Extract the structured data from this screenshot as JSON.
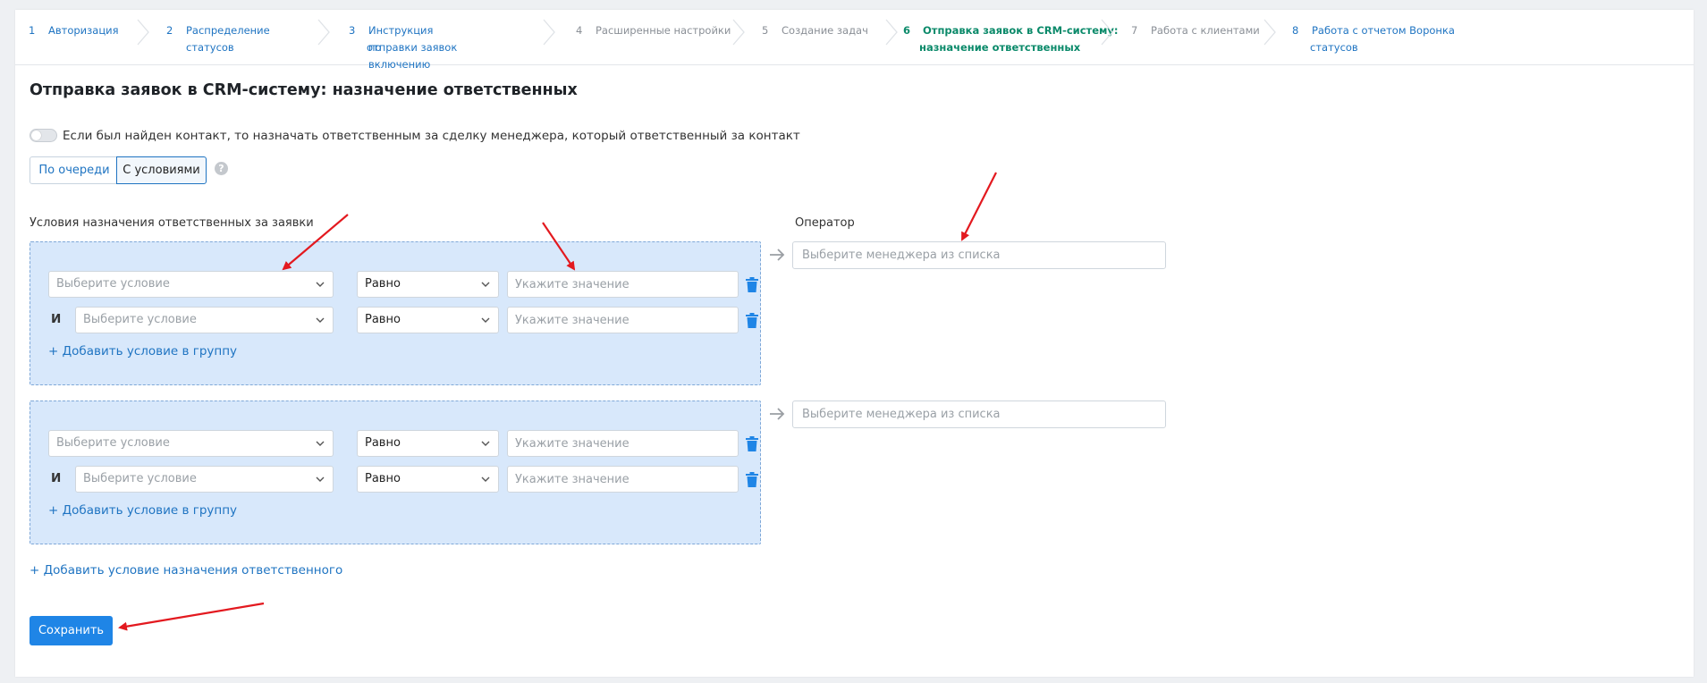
{
  "steps": [
    {
      "num": "1",
      "label": "Авторизация"
    },
    {
      "num": "2",
      "label": "Распределение статусов"
    },
    {
      "num": "3",
      "label_line1": "Инструкция по включению",
      "label_line2": "отправки заявок"
    },
    {
      "num": "4",
      "label": "Расширенные настройки"
    },
    {
      "num": "5",
      "label": "Создание задач"
    },
    {
      "num": "6",
      "label_line1": "Отправка заявок в CRM-систему:",
      "label_line2": "назначение ответственных"
    },
    {
      "num": "7",
      "label": "Работа с клиентами"
    },
    {
      "num": "8",
      "label_line1": "Работа с отчетом Воронка",
      "label_line2": "статусов"
    }
  ],
  "page": {
    "title": "Отправка заявок в CRM-систему: назначение ответственных",
    "toggle_label": "Если был найден контакт, то назначать ответственным за сделку менеджера, который ответственный за контакт",
    "mode_queue": "По очереди",
    "mode_conditions": "С условиями",
    "help": "?",
    "conditions_label": "Условия назначения ответственных за заявки",
    "operator_label": "Оператор"
  },
  "form": {
    "condition_placeholder": "Выберите условие",
    "operator_value": "Равно",
    "value_placeholder": "Укажите значение",
    "and_label": "И",
    "add_to_group": "+ Добавить условие в группу",
    "manager_placeholder": "Выберите менеджера из списка",
    "add_assignment": "+ Добавить условие назначения ответственного",
    "save": "Сохранить"
  },
  "colors": {
    "accent": "#1f85e6",
    "link": "#1f74c2",
    "active_step": "#0b8a6a",
    "group_bg": "#d8e8fb",
    "annotation_arrow": "#e3191f"
  }
}
